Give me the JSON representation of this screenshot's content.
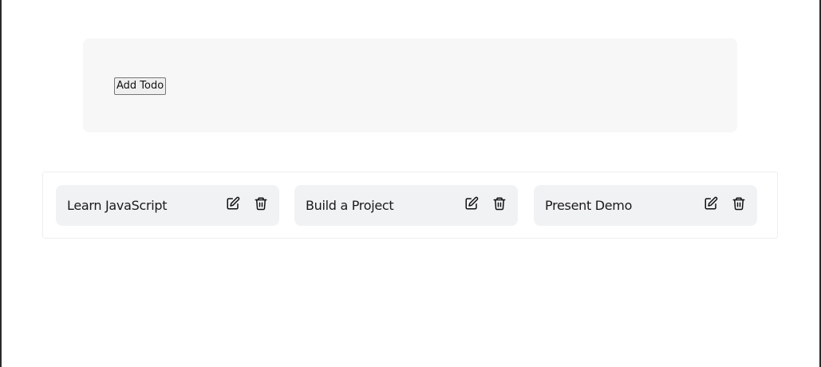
{
  "toolbar": {
    "add_label": "Add Todo"
  },
  "todos": [
    {
      "text": "Learn JavaScript",
      "edit_icon": "edit-icon",
      "delete_icon": "trash-icon"
    },
    {
      "text": "Build a Project",
      "edit_icon": "edit-icon",
      "delete_icon": "trash-icon"
    },
    {
      "text": "Present Demo",
      "edit_icon": "edit-icon",
      "delete_icon": "trash-icon"
    }
  ]
}
